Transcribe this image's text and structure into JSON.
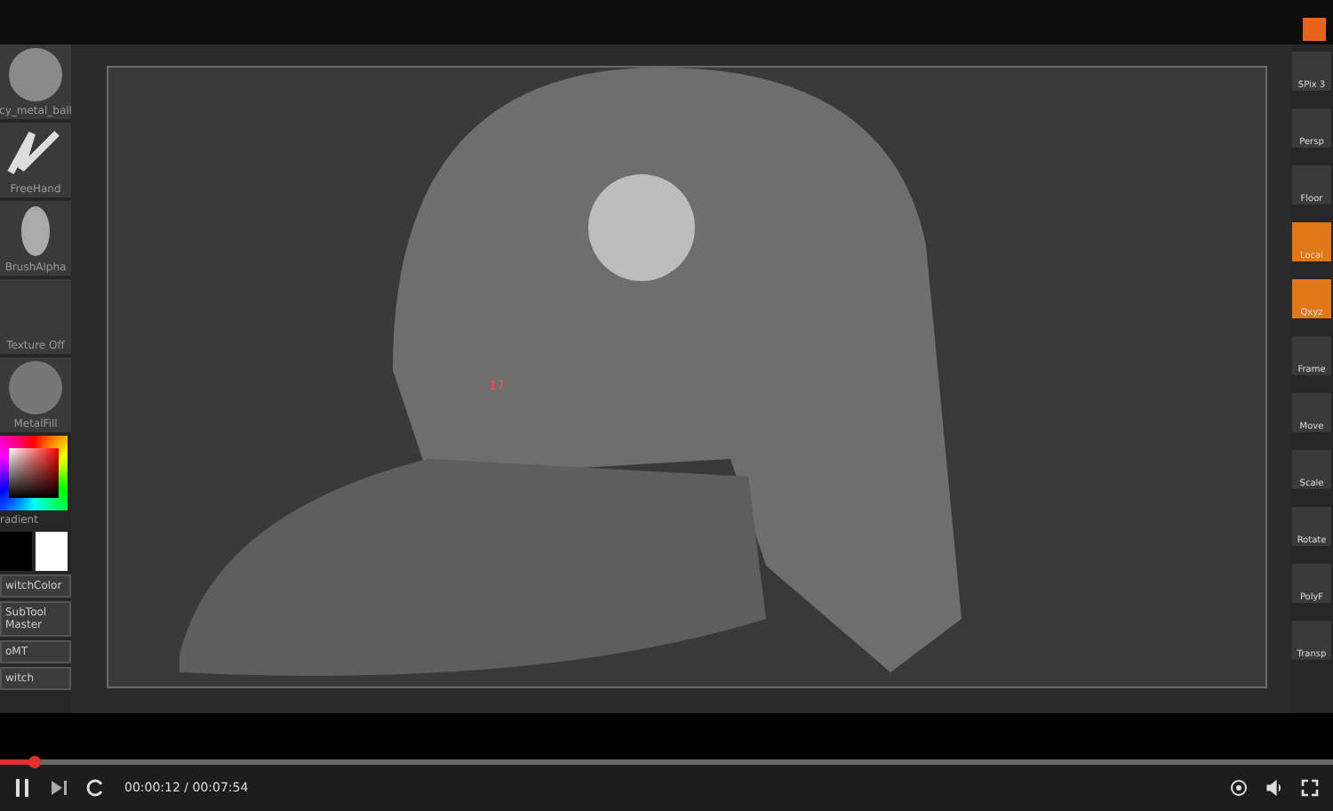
{
  "left_shelf": [
    {
      "kind": "thumb",
      "label": "cy_metal_ball"
    },
    {
      "kind": "thumb",
      "label": "FreeHand"
    },
    {
      "kind": "thumb",
      "label": "BrushAlpha"
    },
    {
      "kind": "thumb",
      "label": "Texture Off"
    },
    {
      "kind": "thumb",
      "label": "MetalFill"
    },
    {
      "kind": "picker",
      "label": "radient"
    },
    {
      "kind": "swatches",
      "label": "witchColor"
    },
    {
      "kind": "button",
      "label": "SubTool Master"
    },
    {
      "kind": "button",
      "label": "oMT"
    },
    {
      "kind": "button",
      "label": "witch"
    }
  ],
  "viewport": {
    "marker": "17"
  },
  "right_shelf": [
    {
      "label": "SPix 3",
      "active": false
    },
    {
      "label": "Persp",
      "active": false
    },
    {
      "label": "Floor",
      "active": false
    },
    {
      "label": "Local",
      "active": true
    },
    {
      "label": "Qxyz",
      "active": true
    },
    {
      "label": "Frame",
      "active": false
    },
    {
      "label": "Move",
      "active": false
    },
    {
      "label": "Scale",
      "active": false
    },
    {
      "label": "Rotate",
      "active": false
    },
    {
      "label": "PolyF",
      "active": false
    },
    {
      "label": "Transp",
      "active": false
    }
  ],
  "player": {
    "playing": true,
    "level": 0.025,
    "time": "00:00:12 / 00:07:54"
  }
}
